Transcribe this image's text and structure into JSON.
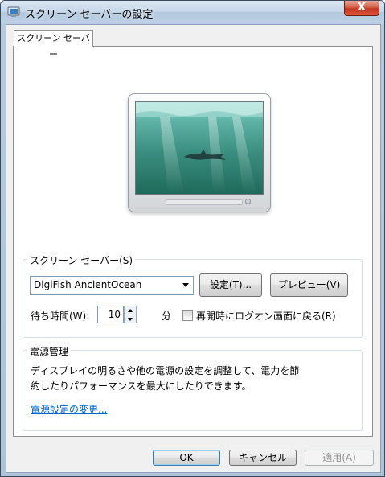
{
  "window": {
    "title": "スクリーン セーバーの設定",
    "close_label": "X"
  },
  "tabs": [
    {
      "label": "スクリーン セーバー",
      "selected": true
    }
  ],
  "screensaver_group": {
    "label": "スクリーン セーバー(S)",
    "selected_screensaver": "DigiFish AncientOcean",
    "settings_button": "設定(T)...",
    "preview_button": "プレビュー(V)",
    "wait_label": "待ち時間(W):",
    "wait_value": "10",
    "wait_unit": "分",
    "resume_logon_label": "再開時にログオン画面に戻る(R)",
    "resume_logon_checked": false
  },
  "power_group": {
    "label": "電源管理",
    "description_line1": "ディスプレイの明るさや他の電源の設定を調整して、電力を節",
    "description_line2": "約したりパフォーマンスを最大にしたりできます。",
    "link": "電源設定の変更..."
  },
  "footer": {
    "ok_label": "OK",
    "cancel_label": "キャンセル",
    "apply_label": "適用(A)"
  },
  "icons": {
    "window_icon": "screensaver-monitor-icon",
    "monitor_preview": "monitor-icon"
  },
  "colors": {
    "link": "#0066cc",
    "close_button": "#c2391f",
    "ocean": "#3a8e7f"
  }
}
